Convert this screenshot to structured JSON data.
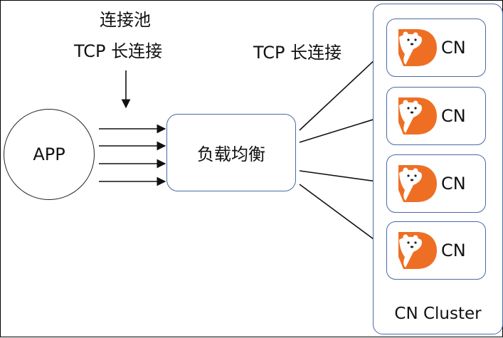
{
  "labels": {
    "pool_line1": "连接池",
    "pool_line2": "TCP 长连接",
    "tcp_long": "TCP 长连接"
  },
  "nodes": {
    "app": "APP",
    "load_balancer": "负载均衡",
    "cluster": "CN Cluster",
    "cn_items": [
      {
        "label": "CN"
      },
      {
        "label": "CN"
      },
      {
        "label": "CN"
      },
      {
        "label": "CN"
      }
    ]
  },
  "colors": {
    "box_border": "#4a6aa6",
    "logo_orange": "#ee6f24",
    "arrow": "#111111"
  },
  "icons": {
    "cn_logo": "bear-in-orange-d-logo"
  }
}
